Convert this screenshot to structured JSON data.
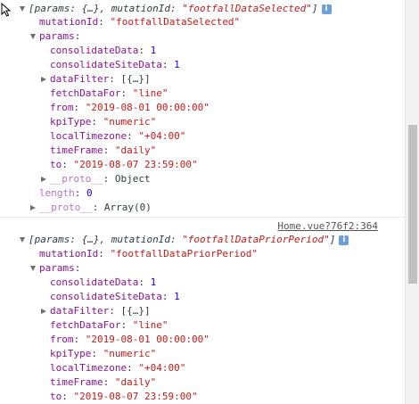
{
  "entries": [
    {
      "summary": {
        "prefix": "[params: {…}, mutationId: ",
        "mutation_id_quoted": "\"footfallDataSelected\"",
        "suffix": "]"
      },
      "mutation_id_key": "mutationId",
      "mutation_id_value": "\"footfallDataSelected\"",
      "params_key": "params",
      "params": {
        "consolidateData": "1",
        "consolidateSiteData": "1",
        "dataFilter": "[{…}]",
        "fetchDataFor": "\"line\"",
        "from": "\"2019-08-01 00:00:00\"",
        "kpiType": "\"numeric\"",
        "localTimezone": "\"+04:00\"",
        "timeFrame": "\"daily\"",
        "to": "\"2019-08-07 23:59:00\"",
        "proto_value": "Object"
      },
      "length_value": "0",
      "array_proto_value": "Array(0)"
    },
    {
      "source_link": "Home.vue?76f2:364",
      "summary": {
        "prefix": "[params: {…}, mutationId: ",
        "mutation_id_quoted": "\"footfallDataPriorPeriod\"",
        "suffix": "]"
      },
      "mutation_id_key": "mutationId",
      "mutation_id_value": "\"footfallDataPriorPeriod\"",
      "params_key": "params",
      "params": {
        "consolidateData": "1",
        "consolidateSiteData": "1",
        "dataFilter": "[{…}]",
        "fetchDataFor": "\"line\"",
        "from": "\"2019-08-01 00:00:00\"",
        "kpiType": "\"numeric\"",
        "localTimezone": "\"+04:00\"",
        "timeFrame": "\"daily\"",
        "to": "\"2019-08-07 23:59:00\""
      }
    }
  ],
  "labels": {
    "consolidateData": "consolidateData",
    "consolidateSiteData": "consolidateSiteData",
    "dataFilter": "dataFilter",
    "fetchDataFor": "fetchDataFor",
    "from": "from",
    "kpiType": "kpiType",
    "localTimezone": "localTimezone",
    "timeFrame": "timeFrame",
    "to": "to",
    "proto": "__proto__",
    "length": "length",
    "info_badge": "i"
  },
  "colors": {
    "key": "#881391",
    "string": "#c41a16",
    "number": "#1c00cf",
    "info_badge": "#6ca0d9"
  },
  "icons": {
    "expanded": "triangle-down-icon",
    "collapsed": "triangle-right-icon",
    "info": "info-badge-icon",
    "cursor": "mouse-pointer-icon"
  }
}
